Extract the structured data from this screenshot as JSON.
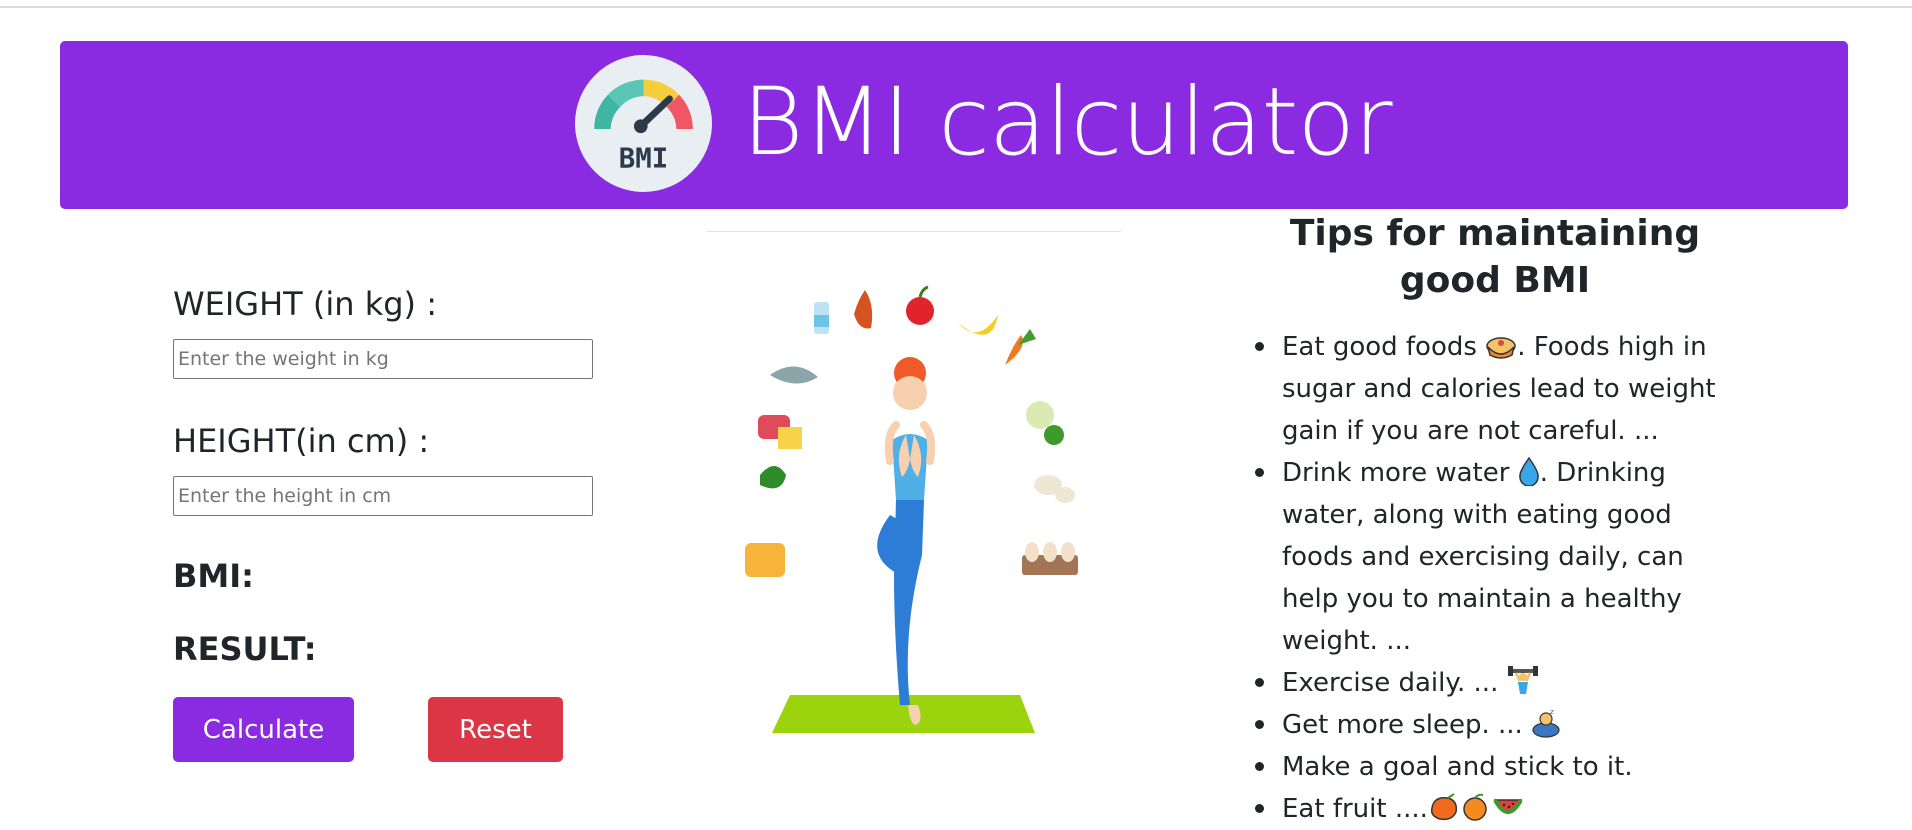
{
  "header": {
    "title": "BMI calculator",
    "logo_text": "BMI"
  },
  "form": {
    "weight_label": "WEIGHT (in kg) :",
    "weight_placeholder": "Enter the weight in kg",
    "weight_value": "",
    "height_label": "HEIGHT(in cm) :",
    "height_placeholder": "Enter the height in cm",
    "height_value": "",
    "bmi_label": "BMI:",
    "result_label": "RESULT:",
    "calculate_label": "Calculate",
    "reset_label": "Reset"
  },
  "tips": {
    "title": "Tips for maintaining good BMI",
    "items": [
      {
        "pre": "Eat good foods",
        "icon": "pie-icon",
        "post": ". Foods high in sugar and calories lead to weight gain if you are not careful. ..."
      },
      {
        "pre": "Drink more water",
        "icon": "water-drop-icon",
        "post": ". Drinking water, along with eating good foods and exercising daily, can help you to maintain a healthy weight. ..."
      },
      {
        "pre": "Exercise daily. ...",
        "icon": "weightlifter-icon",
        "post": ""
      },
      {
        "pre": "Get more sleep. ...",
        "icon": "sleeping-person-icon",
        "post": ""
      },
      {
        "pre": "Make a goal and stick to it.",
        "icon": "",
        "post": ""
      },
      {
        "pre": "Eat fruit ....",
        "icon": "fruit-icons",
        "post": ""
      }
    ]
  },
  "colors": {
    "primary": "#8a2be2",
    "danger": "#dc3545",
    "text": "#212529"
  }
}
